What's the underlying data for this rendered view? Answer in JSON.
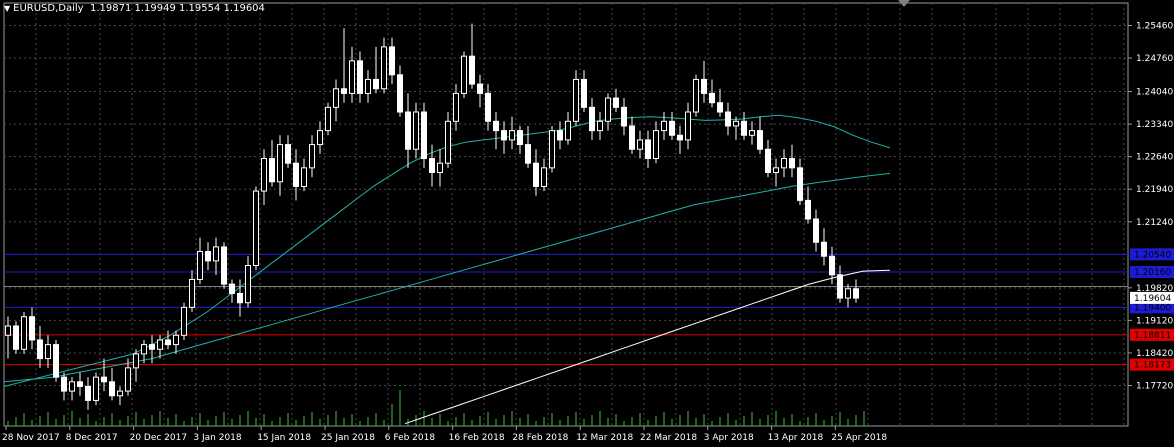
{
  "header": {
    "symbol": "EURUSD,Daily",
    "ohlc": "1.19871 1.19949 1.19554 1.19604"
  },
  "colors": {
    "background": "#000000",
    "grid": "#4a4a4a",
    "text": "#ffffff",
    "candle_stroke": "#ffffff",
    "bear_fill": "#ffffff",
    "bull_fill": "#000000",
    "ma_fast": "#20b2aa",
    "ma_mid": "#20b2aa",
    "ma_slow": "#ffffff",
    "volume": "#32cd32",
    "level_blue": "#1c1cd6",
    "level_red": "#e10000",
    "level_gray": "#808080"
  },
  "chart_data": {
    "type": "candlestick",
    "ylim": [
      1.1685,
      1.2575
    ],
    "y_ticks": [
      "1.25460",
      "1.24760",
      "1.24040",
      "1.23340",
      "1.22640",
      "1.21940",
      "1.21240",
      "1.19820",
      "1.19120",
      "1.18420",
      "1.17720"
    ],
    "x_ticks": [
      "28 Nov 2017",
      "8 Dec 2017",
      "20 Dec 2017",
      "3 Jan 2018",
      "15 Jan 2018",
      "25 Jan 2018",
      "6 Feb 2018",
      "16 Feb 2018",
      "28 Feb 2018",
      "12 Mar 2018",
      "22 Mar 2018",
      "3 Apr 2018",
      "13 Apr 2018",
      "25 Apr 2018"
    ],
    "current_price": {
      "value": 1.19604,
      "label": "1.19604"
    },
    "levels": [
      {
        "value": 1.2054,
        "label": "1.20540",
        "color": "blue"
      },
      {
        "value": 1.2016,
        "label": "1.20160",
        "color": "blue"
      },
      {
        "value": 1.1985,
        "label": "",
        "color": "gray"
      },
      {
        "value": 1.194,
        "label": "1.19400",
        "color": "blue"
      },
      {
        "value": 1.1881,
        "label": "1.18811",
        "color": "red"
      },
      {
        "value": 1.1817,
        "label": "1.18173",
        "color": "red"
      }
    ],
    "candles": [
      [
        1.188,
        1.192,
        1.183,
        1.19
      ],
      [
        1.19,
        1.191,
        1.184,
        1.185
      ],
      [
        1.185,
        1.193,
        1.184,
        1.192
      ],
      [
        1.192,
        1.194,
        1.185,
        1.187
      ],
      [
        1.187,
        1.19,
        1.181,
        1.183
      ],
      [
        1.183,
        1.188,
        1.181,
        1.186
      ],
      [
        1.186,
        1.187,
        1.178,
        1.179
      ],
      [
        1.179,
        1.18,
        1.174,
        1.176
      ],
      [
        1.176,
        1.179,
        1.174,
        1.178
      ],
      [
        1.178,
        1.18,
        1.175,
        1.177
      ],
      [
        1.177,
        1.179,
        1.172,
        1.174
      ],
      [
        1.174,
        1.18,
        1.173,
        1.179
      ],
      [
        1.179,
        1.183,
        1.176,
        1.178
      ],
      [
        1.178,
        1.181,
        1.174,
        1.175
      ],
      [
        1.175,
        1.177,
        1.173,
        1.176
      ],
      [
        1.176,
        1.183,
        1.175,
        1.181
      ],
      [
        1.181,
        1.185,
        1.178,
        1.184
      ],
      [
        1.184,
        1.187,
        1.182,
        1.186
      ],
      [
        1.186,
        1.188,
        1.182,
        1.185
      ],
      [
        1.185,
        1.188,
        1.183,
        1.187
      ],
      [
        1.187,
        1.189,
        1.185,
        1.186
      ],
      [
        1.186,
        1.189,
        1.184,
        1.188
      ],
      [
        1.188,
        1.195,
        1.187,
        1.194
      ],
      [
        1.194,
        1.202,
        1.193,
        1.2
      ],
      [
        1.2,
        1.209,
        1.199,
        1.206
      ],
      [
        1.206,
        1.208,
        1.202,
        1.204
      ],
      [
        1.204,
        1.209,
        1.201,
        1.207
      ],
      [
        1.207,
        1.208,
        1.198,
        1.199
      ],
      [
        1.199,
        1.2,
        1.195,
        1.197
      ],
      [
        1.197,
        1.2,
        1.192,
        1.195
      ],
      [
        1.195,
        1.205,
        1.194,
        1.203
      ],
      [
        1.203,
        1.22,
        1.202,
        1.219
      ],
      [
        1.219,
        1.228,
        1.216,
        1.226
      ],
      [
        1.226,
        1.23,
        1.22,
        1.221
      ],
      [
        1.221,
        1.231,
        1.218,
        1.229
      ],
      [
        1.229,
        1.231,
        1.224,
        1.225
      ],
      [
        1.225,
        1.228,
        1.217,
        1.22
      ],
      [
        1.22,
        1.226,
        1.219,
        1.224
      ],
      [
        1.224,
        1.231,
        1.222,
        1.229
      ],
      [
        1.229,
        1.234,
        1.227,
        1.232
      ],
      [
        1.232,
        1.238,
        1.231,
        1.237
      ],
      [
        1.237,
        1.243,
        1.234,
        1.241
      ],
      [
        1.241,
        1.254,
        1.238,
        1.24
      ],
      [
        1.24,
        1.25,
        1.238,
        1.247
      ],
      [
        1.247,
        1.249,
        1.238,
        1.24
      ],
      [
        1.24,
        1.245,
        1.238,
        1.243
      ],
      [
        1.243,
        1.25,
        1.24,
        1.241
      ],
      [
        1.241,
        1.252,
        1.24,
        1.25
      ],
      [
        1.25,
        1.252,
        1.242,
        1.244
      ],
      [
        1.244,
        1.246,
        1.235,
        1.236
      ],
      [
        1.236,
        1.24,
        1.224,
        1.228
      ],
      [
        1.228,
        1.238,
        1.226,
        1.236
      ],
      [
        1.236,
        1.238,
        1.224,
        1.226
      ],
      [
        1.226,
        1.229,
        1.22,
        1.223
      ],
      [
        1.223,
        1.228,
        1.22,
        1.225
      ],
      [
        1.225,
        1.236,
        1.224,
        1.234
      ],
      [
        1.234,
        1.242,
        1.232,
        1.24
      ],
      [
        1.24,
        1.249,
        1.239,
        1.248
      ],
      [
        1.248,
        1.255,
        1.241,
        1.242
      ],
      [
        1.242,
        1.244,
        1.237,
        1.24
      ],
      [
        1.24,
        1.242,
        1.232,
        1.234
      ],
      [
        1.234,
        1.236,
        1.228,
        1.232
      ],
      [
        1.232,
        1.234,
        1.227,
        1.23
      ],
      [
        1.23,
        1.235,
        1.228,
        1.232
      ],
      [
        1.232,
        1.233,
        1.227,
        1.229
      ],
      [
        1.229,
        1.233,
        1.224,
        1.225
      ],
      [
        1.225,
        1.228,
        1.218,
        1.22
      ],
      [
        1.22,
        1.226,
        1.219,
        1.224
      ],
      [
        1.224,
        1.233,
        1.223,
        1.232
      ],
      [
        1.232,
        1.234,
        1.228,
        1.23
      ],
      [
        1.23,
        1.236,
        1.229,
        1.234
      ],
      [
        1.234,
        1.245,
        1.233,
        1.243
      ],
      [
        1.243,
        1.245,
        1.236,
        1.237
      ],
      [
        1.237,
        1.239,
        1.23,
        1.232
      ],
      [
        1.232,
        1.236,
        1.23,
        1.234
      ],
      [
        1.234,
        1.24,
        1.232,
        1.239
      ],
      [
        1.239,
        1.241,
        1.236,
        1.237
      ],
      [
        1.237,
        1.239,
        1.231,
        1.233
      ],
      [
        1.233,
        1.235,
        1.227,
        1.228
      ],
      [
        1.228,
        1.232,
        1.226,
        1.23
      ],
      [
        1.23,
        1.232,
        1.224,
        1.226
      ],
      [
        1.226,
        1.234,
        1.225,
        1.232
      ],
      [
        1.232,
        1.236,
        1.23,
        1.234
      ],
      [
        1.234,
        1.236,
        1.23,
        1.231
      ],
      [
        1.231,
        1.233,
        1.227,
        1.23
      ],
      [
        1.23,
        1.238,
        1.228,
        1.236
      ],
      [
        1.236,
        1.244,
        1.235,
        1.243
      ],
      [
        1.243,
        1.247,
        1.238,
        1.24
      ],
      [
        1.24,
        1.243,
        1.237,
        1.238
      ],
      [
        1.238,
        1.241,
        1.235,
        1.236
      ],
      [
        1.236,
        1.238,
        1.231,
        1.233
      ],
      [
        1.233,
        1.235,
        1.23,
        1.234
      ],
      [
        1.234,
        1.236,
        1.23,
        1.231
      ],
      [
        1.231,
        1.234,
        1.229,
        1.232
      ],
      [
        1.232,
        1.235,
        1.227,
        1.228
      ],
      [
        1.228,
        1.23,
        1.222,
        1.223
      ],
      [
        1.223,
        1.226,
        1.22,
        1.224
      ],
      [
        1.224,
        1.228,
        1.222,
        1.226
      ],
      [
        1.226,
        1.229,
        1.222,
        1.224
      ],
      [
        1.224,
        1.226,
        1.216,
        1.217
      ],
      [
        1.217,
        1.22,
        1.212,
        1.213
      ],
      [
        1.213,
        1.215,
        1.206,
        1.208
      ],
      [
        1.208,
        1.211,
        1.203,
        1.205
      ],
      [
        1.205,
        1.207,
        1.199,
        1.201
      ],
      [
        1.201,
        1.203,
        1.195,
        1.196
      ],
      [
        1.196,
        1.199,
        1.194,
        1.198
      ],
      [
        1.198,
        1.2,
        1.195,
        1.196
      ]
    ],
    "series": [
      {
        "kind": "ma_fast",
        "values": [
          1.177,
          1.178,
          1.179,
          1.18,
          1.181,
          1.182,
          1.183,
          1.184,
          1.186,
          1.188,
          1.1905,
          1.193,
          1.196,
          1.199,
          1.202,
          1.205,
          1.208,
          1.211,
          1.214,
          1.217,
          1.22,
          1.2225,
          1.225,
          1.227,
          1.2285,
          1.2295,
          1.23,
          1.2305,
          1.231,
          1.2315,
          1.232,
          1.233,
          1.234,
          1.2345,
          1.2348,
          1.235,
          1.2348,
          1.2345,
          1.2342,
          1.2343,
          1.2345,
          1.235,
          1.2353,
          1.2348,
          1.234,
          1.2328,
          1.231,
          1.2295,
          1.2283
        ]
      },
      {
        "kind": "ma_mid",
        "values": [
          1.178,
          1.1785,
          1.179,
          1.18,
          1.181,
          1.182,
          1.183,
          1.1845,
          1.186,
          1.1875,
          1.189,
          1.1905,
          1.192,
          1.1935,
          1.195,
          1.1965,
          1.198,
          1.1995,
          1.201,
          1.2025,
          1.204,
          1.2055,
          1.207,
          1.2085,
          1.21,
          1.2115,
          1.213,
          1.2145,
          1.216,
          1.217,
          1.218,
          1.219,
          1.22,
          1.2208,
          1.2215,
          1.2222,
          1.2228
        ]
      },
      {
        "kind": "ma_slow",
        "values": [
          1.169,
          1.171,
          1.173,
          1.175,
          1.177,
          1.179,
          1.181,
          1.183,
          1.185,
          1.187,
          1.189,
          1.191,
          1.193,
          1.195,
          1.197,
          1.199,
          1.2005,
          1.2018,
          1.202
        ]
      }
    ],
    "volume_bars": 108
  }
}
